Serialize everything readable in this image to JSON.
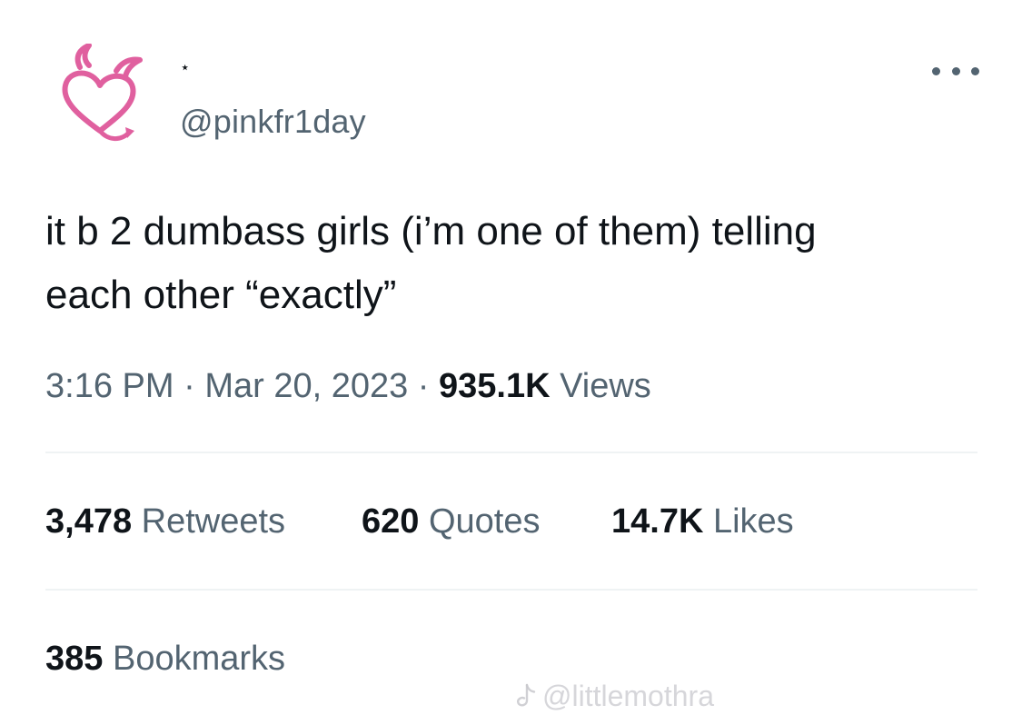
{
  "author": {
    "display_name": "⋆",
    "handle": "@pinkfr1day",
    "avatar_icon": "pink-devil-heart-icon",
    "avatar_color": "#e0609f"
  },
  "more_icon": "more-horizontal-icon",
  "tweet": {
    "text": "it b 2 dumbass girls (i’m one of them) telling\neach other “exactly”",
    "time": "3:16 PM",
    "date": "Mar 20, 2023",
    "separator": " · ",
    "views_count": "935.1K",
    "views_label": "Views"
  },
  "stats": {
    "retweets_count": "3,478",
    "retweets_label": "Retweets",
    "quotes_count": "620",
    "quotes_label": "Quotes",
    "likes_count": "14.7K",
    "likes_label": "Likes",
    "bookmarks_count": "385",
    "bookmarks_label": "Bookmarks"
  },
  "watermark": {
    "icon": "tiktok-icon",
    "text": "@littlemothra"
  },
  "colors": {
    "text_primary": "#0f1419",
    "text_secondary": "#536471",
    "divider": "#eff3f4",
    "accent_pink": "#e0609f"
  }
}
